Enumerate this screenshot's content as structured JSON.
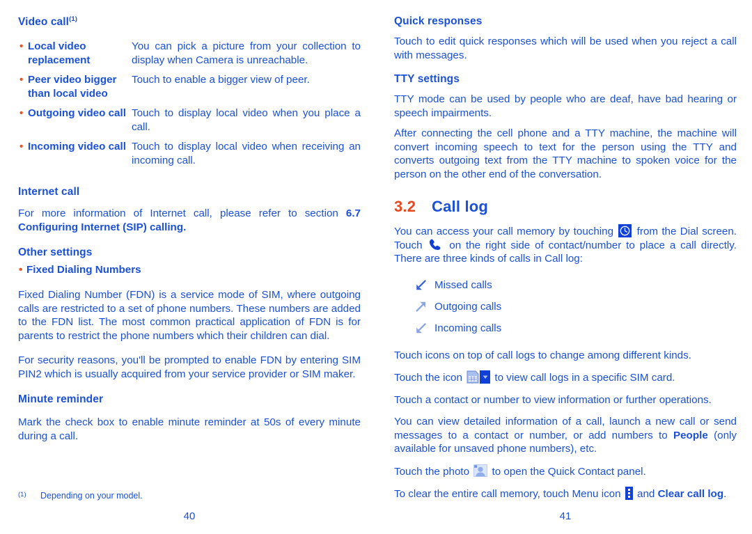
{
  "colors": {
    "text_blue": "#1b50d8",
    "accent_orange": "#e8481c",
    "icon_blue": "#1140d6",
    "icon_light_blue": "#9db6ee"
  },
  "left_page": {
    "folio": "40",
    "video_call": {
      "heading": "Video call",
      "footnote_marker": "(1)",
      "rows": [
        {
          "term": "Local video replacement",
          "desc": "You can pick a picture from your collection to display when Camera is unreachable."
        },
        {
          "term": "Peer video bigger than local video",
          "desc": "Touch to enable a bigger view of peer."
        },
        {
          "term": "Outgoing video call",
          "desc": "Touch to display local video when you place a call."
        },
        {
          "term": "Incoming video call",
          "desc": "Touch to display local video when receiving an incoming call."
        }
      ]
    },
    "internet_call": {
      "heading": "Internet call",
      "para_lead": "For more information of Internet call, please refer to section ",
      "para_bold": "6.7 Configuring Internet (SIP) calling."
    },
    "other_settings": {
      "heading": "Other settings",
      "bullet_heading": "Fixed Dialing Numbers",
      "para1": "Fixed Dialing Number (FDN) is a service mode of SIM, where outgoing calls are restricted to a set of phone numbers. These numbers are added to the FDN list. The most common practical application of FDN is for parents to restrict the phone numbers which their children can dial.",
      "para2": "For security reasons, you'll be prompted to enable FDN by entering SIM PIN2 which is usually acquired from your service provider or SIM maker."
    },
    "minute_reminder": {
      "heading": "Minute reminder",
      "para": "Mark the check box to enable minute reminder at 50s of every minute during a call."
    },
    "footnote": {
      "marker": "(1)",
      "text": "Depending on your model."
    }
  },
  "right_page": {
    "folio": "41",
    "quick_responses": {
      "heading": "Quick responses",
      "para": "Touch to edit quick responses which will be used when you reject a call with messages."
    },
    "tty_settings": {
      "heading": "TTY settings",
      "para1": "TTY mode can be used by people who are deaf, have bad hearing or speech impairments.",
      "para2": "After connecting the cell phone and a TTY machine, the machine will convert incoming speech to text for the person using the TTY and converts outgoing text from the TTY machine to spoken voice for the person on the other end of the conversation."
    },
    "call_log": {
      "number": "3.2",
      "title": "Call log",
      "intro_a": "You can access your call memory by touching ",
      "intro_b": " from the Dial screen. Touch ",
      "intro_c": " on the right side of contact/number to place a call directly. There are three kinds of calls in Call log:",
      "legend": [
        {
          "icon": "arrow-down-left-icon",
          "label": "Missed calls"
        },
        {
          "icon": "arrow-up-right-icon",
          "label": "Outgoing calls"
        },
        {
          "icon": "arrow-down-left-icon",
          "label": "Incoming calls"
        }
      ],
      "para_icons_top": "Touch icons on top of call logs to change among different kinds.",
      "para_sim_a": "Touch the icon ",
      "para_sim_b": " to view call logs in a specific SIM card.",
      "para_contact": "Touch a contact or number to view information or further operations.",
      "para_detail_a": "You can view detailed information of a call, launch a new call or send messages to a contact or number, or add numbers to ",
      "para_detail_bold": "People",
      "para_detail_b": " (only available for unsaved phone numbers), etc.",
      "para_photo_a": "Touch the photo ",
      "para_photo_b": " to open the Quick Contact panel.",
      "para_clear_a": "To clear the entire call memory, touch Menu icon ",
      "para_clear_b": " and ",
      "para_clear_bold": "Clear call log",
      "para_clear_c": "."
    }
  }
}
